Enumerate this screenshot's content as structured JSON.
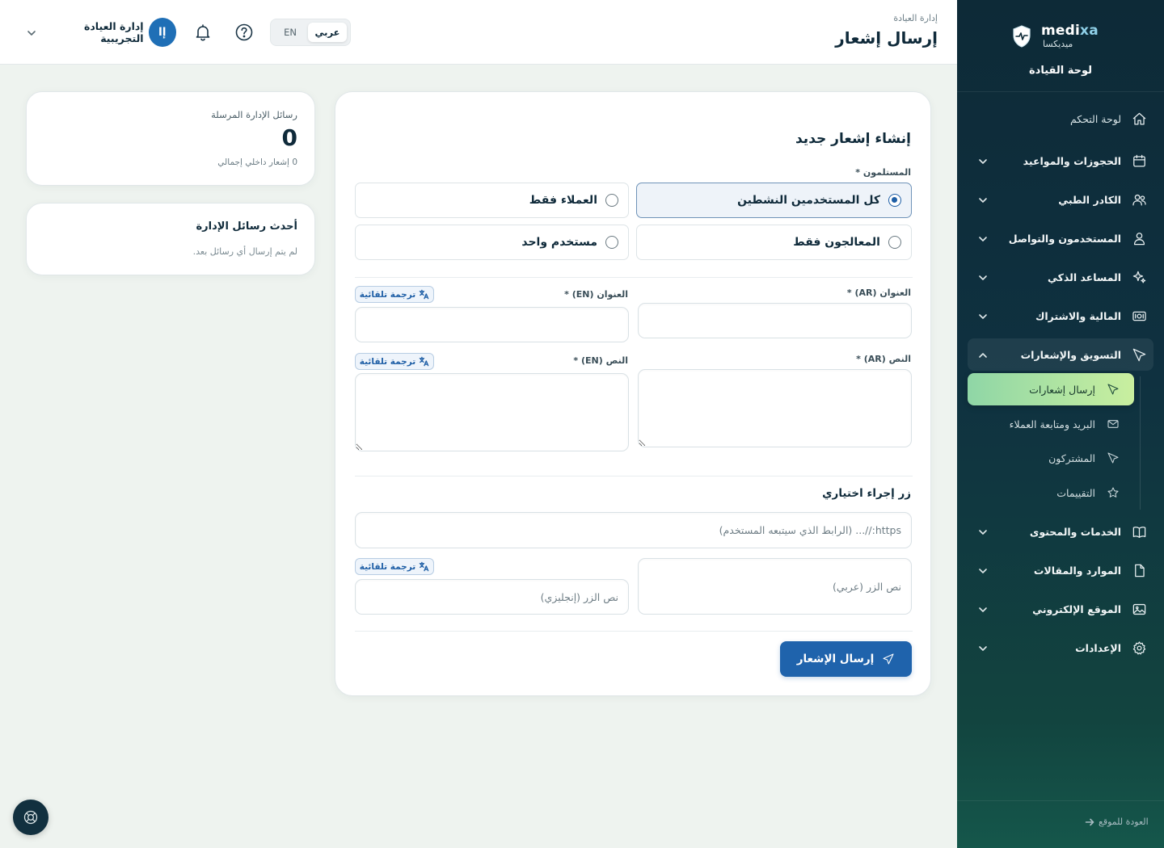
{
  "sidebar": {
    "brand_name_a": "medi",
    "brand_name_b": "xa",
    "brand_sub": "ميديكسا",
    "panel_title": "لوحة القيادة",
    "items": [
      {
        "label": "لوحة التحكم",
        "icon": "home-icon"
      },
      {
        "label": "الحجوزات والمواعيد",
        "icon": "calendar-icon"
      },
      {
        "label": "الكادر الطبي",
        "icon": "users-icon"
      },
      {
        "label": "المستخدمون والتواصل",
        "icon": "user-icon"
      },
      {
        "label": "المساعد الذكي",
        "icon": "sparkles-icon"
      },
      {
        "label": "المالية والاشتراك",
        "icon": "money-icon"
      },
      {
        "label": "التسويق والإشعارات",
        "icon": "send-icon"
      },
      {
        "label": "الخدمات والمحتوى",
        "icon": "book-icon"
      },
      {
        "label": "الموارد والمقالات",
        "icon": "file-icon"
      },
      {
        "label": "الموقع الإلكتروني",
        "icon": "image-icon"
      },
      {
        "label": "الإعدادات",
        "icon": "gear-icon"
      }
    ],
    "sub_items": [
      {
        "label": "إرسال إشعارات",
        "icon": "send-icon",
        "active": true
      },
      {
        "label": "البريد ومتابعة العملاء",
        "icon": "mail-icon"
      },
      {
        "label": "المشتركون",
        "icon": "send-icon"
      },
      {
        "label": "التقييمات",
        "icon": "star-icon"
      }
    ],
    "back_link": "العودة للموقع"
  },
  "header": {
    "breadcrumb": "إدارة العيادة",
    "title": "إرسال إشعار",
    "lang_en": "EN",
    "lang_ar": "عربي",
    "user_name": "إدارة العيادة التجريبية",
    "avatar_initials": "إا"
  },
  "form": {
    "title": "إنشاء إشعار جديد",
    "recipients_label": "المستلمون *",
    "recipients": {
      "all_active": "كل المستخدمين النشطين",
      "clients_only": "العملاء فقط",
      "therapists_only": "المعالجون فقط",
      "single_user": "مستخدم واحد"
    },
    "title_ar_label": "العنوان (AR) *",
    "title_en_label": "العنوان (EN) *",
    "body_ar_label": "النص (AR) *",
    "body_en_label": "النص (EN) *",
    "auto_translate": "ترجمة تلقائية",
    "action_section": "زر إجراء اختياري",
    "url_placeholder": "https://... (الرابط الذي سيتبعه المستخدم)",
    "btn_ar_placeholder": "نص الزر (عربي)",
    "btn_en_placeholder": "نص الزر (إنجليزي)",
    "submit": "إرسال الإشعار"
  },
  "stats": {
    "label": "رسائل الإدارة المرسلة",
    "value": "0",
    "sub": "0 إشعار داخلي إجمالي"
  },
  "recent": {
    "title": "أحدث رسائل الإدارة",
    "empty": "لم يتم إرسال أي رسائل بعد."
  },
  "colors": {
    "sidebar_bg": "#0d2a37",
    "primary": "#1f63ac",
    "active_sub": "#c9ef9f"
  }
}
